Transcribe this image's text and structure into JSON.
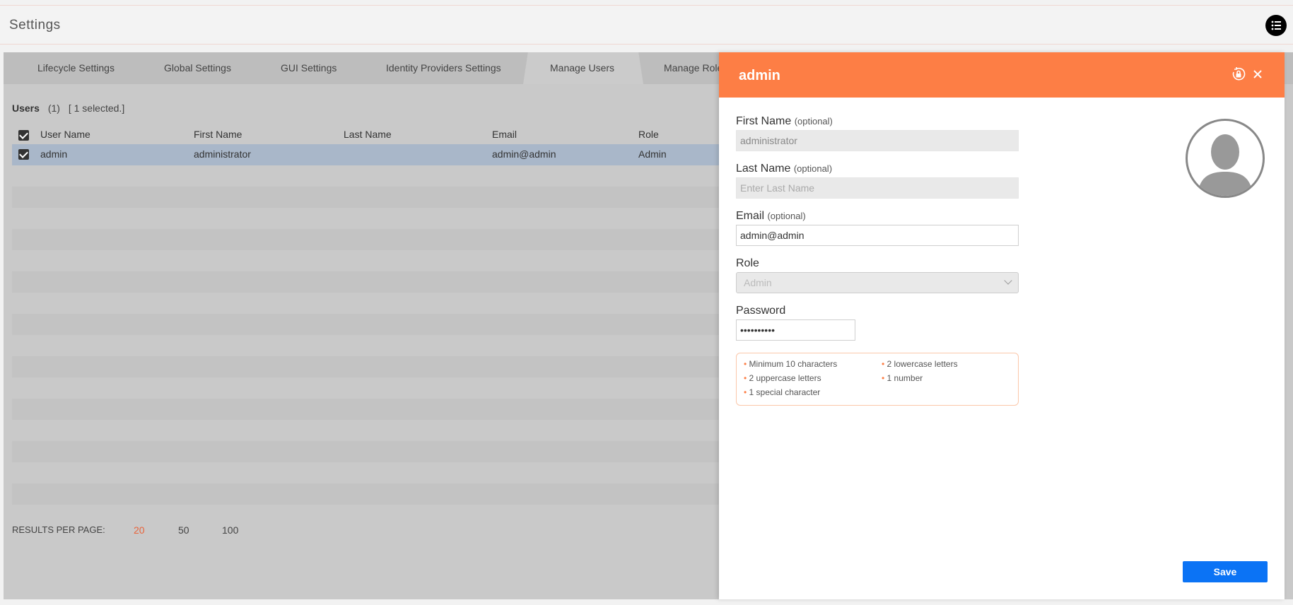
{
  "header": {
    "title": "Settings",
    "menu_icon": "list-icon"
  },
  "tabs": [
    {
      "label": "Lifecycle Settings"
    },
    {
      "label": "Global Settings"
    },
    {
      "label": "GUI Settings"
    },
    {
      "label": "Identity Providers Settings"
    },
    {
      "label": "Manage Users",
      "active": true
    },
    {
      "label": "Manage Role"
    }
  ],
  "users": {
    "label": "Users",
    "count": "(1)",
    "selected": "[ 1 selected.]",
    "columns": [
      "User Name",
      "First Name",
      "Last Name",
      "Email",
      "Role"
    ],
    "rows": [
      {
        "user_name": "admin",
        "first_name": "administrator",
        "last_name": "",
        "email": "admin@admin",
        "role": "Admin",
        "selected": true
      }
    ]
  },
  "pagination": {
    "label": "RESULTS PER PAGE:",
    "options": [
      "20",
      "50",
      "100"
    ],
    "active": "20"
  },
  "panel": {
    "title": "admin",
    "first_name": {
      "label": "First Name",
      "hint": "(optional)",
      "value": "administrator"
    },
    "last_name": {
      "label": "Last Name",
      "hint": "(optional)",
      "placeholder": "Enter Last Name"
    },
    "email": {
      "label": "Email",
      "hint": "(optional)",
      "value": "admin@admin"
    },
    "role": {
      "label": "Role",
      "value": "Admin"
    },
    "password": {
      "label": "Password",
      "value": "••••••••••"
    },
    "rules": [
      "Minimum 10 characters",
      "2 lowercase letters",
      "2 uppercase letters",
      "1 number",
      "1 special character"
    ],
    "save_label": "Save",
    "accent": "#fd7e45",
    "save_color": "#0b73f5"
  }
}
